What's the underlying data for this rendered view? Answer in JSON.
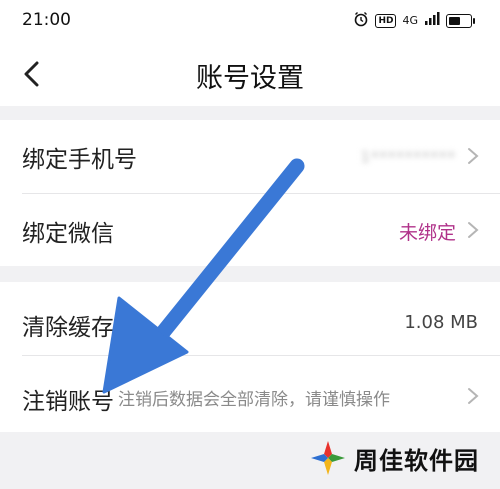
{
  "status_bar": {
    "time": "21:00",
    "network": "4G",
    "hd": "HD",
    "battery_level": 0.55
  },
  "nav": {
    "title": "账号设置"
  },
  "rows": {
    "phone": {
      "label": "绑定手机号",
      "value": "1**********"
    },
    "wechat": {
      "label": "绑定微信",
      "value": "未绑定"
    },
    "cache": {
      "label": "清除缓存",
      "value": "1.08 MB"
    },
    "cancel": {
      "label": "注销账号",
      "hint": "注销后数据会全部清除，请谨慎操作"
    }
  },
  "colors": {
    "accent_pink": "#b0328a",
    "arrow_blue": "#3a78d6",
    "background": "#f1f1f3"
  },
  "watermark": {
    "text": "周佳软件园"
  },
  "icons": [
    "back-arrow-icon",
    "chevron-right-icon",
    "alarm-icon",
    "signal-icon",
    "battery-icon"
  ]
}
